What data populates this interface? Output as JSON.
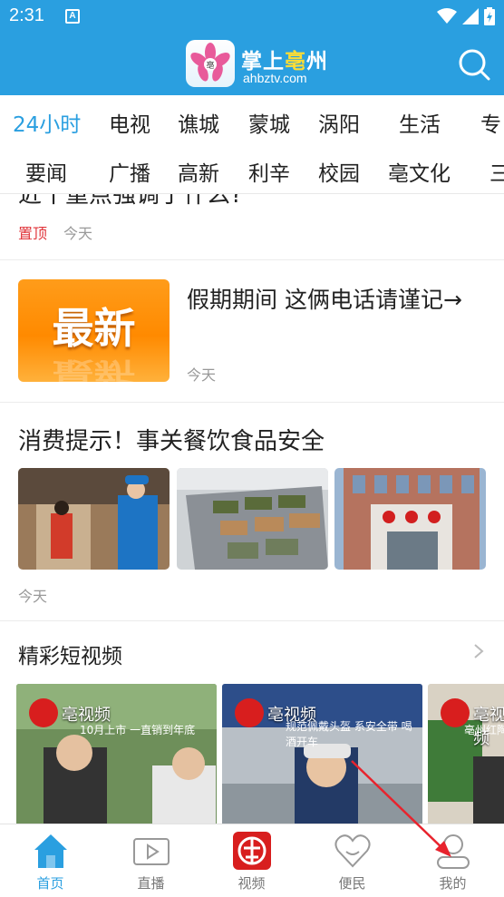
{
  "status_bar": {
    "time": "2:31",
    "notif_letter": "A"
  },
  "header": {
    "app_name_part1": "掌上",
    "app_name_part2": "亳",
    "app_name_part3": "州",
    "domain": "ahbztv.com"
  },
  "tabs_row1": [
    "24小时",
    "电视",
    "谯城",
    "蒙城",
    "涡阳",
    "生活",
    "专"
  ],
  "tabs_row2": [
    "要闻",
    "广播",
    "高新",
    "利辛",
    "校园",
    "亳文化",
    "三"
  ],
  "active_tab": "24小时",
  "feed": {
    "cut_item": {
      "title": "近十重点强调了什么?",
      "tag": "置顶",
      "time": "今天"
    },
    "news_item": {
      "thumb_text": "最新",
      "title": "假期期间 这俩电话请谨记→",
      "time": "今天"
    },
    "photo_item": {
      "title": "消费提示！事关餐饮食品安全",
      "time": "今天"
    },
    "short_video": {
      "section_title": "精彩短视频",
      "cards": [
        {
          "label": "亳视频",
          "caption": "10月上市 一直销到年底"
        },
        {
          "label": "亳视频",
          "caption": "规范佩戴头盔 系安全带 喝酒开车"
        },
        {
          "label": "亳视频",
          "caption": "亳州红陶"
        }
      ]
    }
  },
  "bottom_nav": [
    {
      "label": "首页",
      "icon": "home-icon"
    },
    {
      "label": "直播",
      "icon": "live-video-icon"
    },
    {
      "label": "视频",
      "icon": "video-logo-icon"
    },
    {
      "label": "便民",
      "icon": "heart-icon"
    },
    {
      "label": "我的",
      "icon": "user-icon"
    }
  ],
  "colors": {
    "accent": "#2a9fe0",
    "tag_red": "#e0353b",
    "annotation_red": "#e8232d"
  }
}
